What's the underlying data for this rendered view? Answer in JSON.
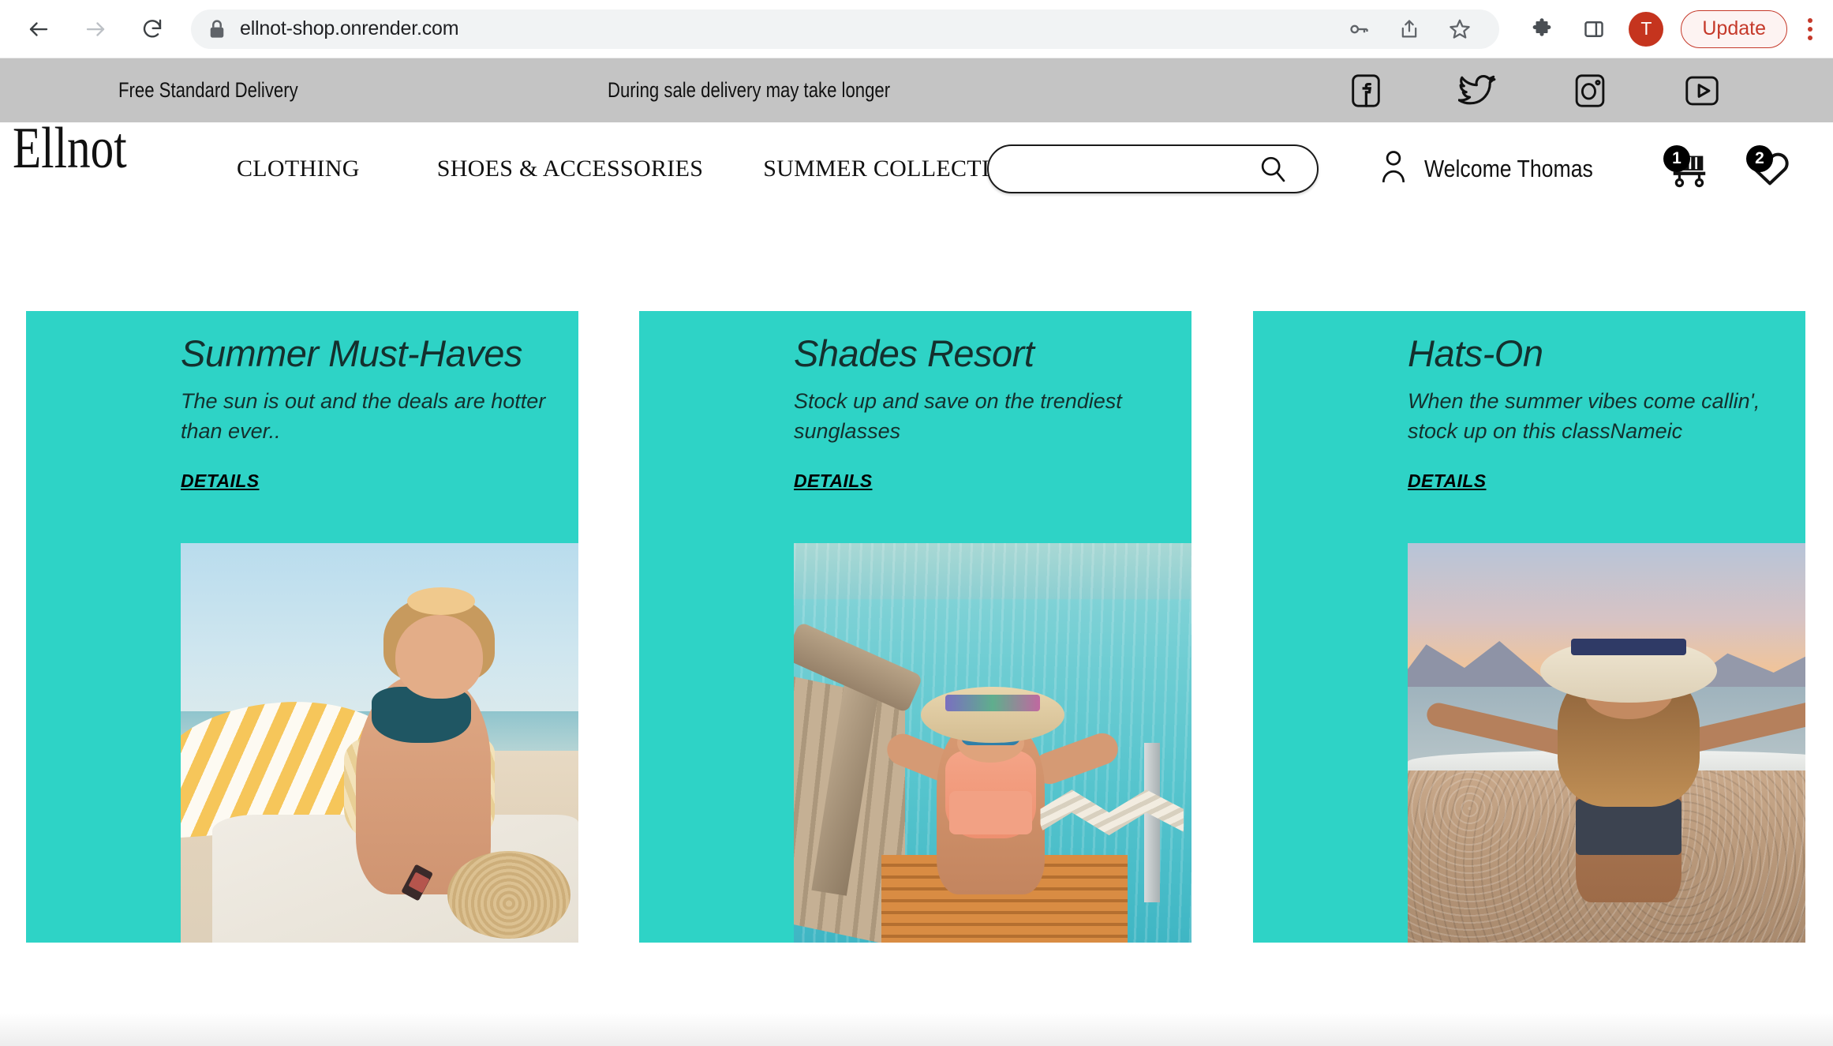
{
  "browser": {
    "url": "ellnot-shop.onrender.com",
    "back_label": "Back",
    "forward_label": "Forward",
    "reload_label": "Reload",
    "lock_icon": "lock-icon",
    "omnibox_actions": [
      "key-icon",
      "share-icon",
      "bookmark-star-icon"
    ],
    "extensions_icon": "puzzle-piece-icon",
    "sidepanel_icon": "side-panel-icon",
    "profile_initial": "T",
    "update_label": "Update",
    "menu_icon": "kebab-menu-icon"
  },
  "announcement": {
    "left_text": "Free Standard Delivery",
    "right_text": "During sale delivery may take longer",
    "socials": [
      {
        "name": "facebook-icon",
        "label": "Facebook"
      },
      {
        "name": "twitter-icon",
        "label": "Twitter"
      },
      {
        "name": "instagram-icon",
        "label": "Instagram"
      },
      {
        "name": "youtube-icon",
        "label": "YouTube"
      }
    ],
    "background": "#C4C4C4"
  },
  "header": {
    "brand": "Ellnot",
    "nav": [
      {
        "label": "CLOTHING"
      },
      {
        "label": "SHOES & ACCESSORIES"
      },
      {
        "label": "SUMMER COLLECTION"
      }
    ],
    "search": {
      "value": "",
      "placeholder": "",
      "icon": "search-icon"
    },
    "account": {
      "icon": "user-icon",
      "greeting": "Welcome Thomas"
    },
    "cart": {
      "icon": "shopping-cart-icon",
      "count": "1"
    },
    "wishlist": {
      "icon": "heart-icon",
      "count": "2"
    }
  },
  "promos": {
    "accent_color": "#2ED3C6",
    "cards": [
      {
        "title": "Summer Must-Haves",
        "description": "The sun is out and the deals are hotter than ever..",
        "cta": "DETAILS",
        "image_alt": "Smiling woman at the beach beside a yellow striped umbrella"
      },
      {
        "title": "Shades Resort",
        "description": "Stock up and save on the trendiest sunglasses",
        "cta": "DETAILS",
        "image_alt": "Woman in straw hat climbing a wooden pier ladder out of turquoise water"
      },
      {
        "title": "Hats-On",
        "description": "When the summer vibes come callin', stock up on this classNameic",
        "cta": "DETAILS",
        "image_alt": "Woman with a wide-brim hat on a sunset beach with arms outstretched"
      }
    ]
  }
}
